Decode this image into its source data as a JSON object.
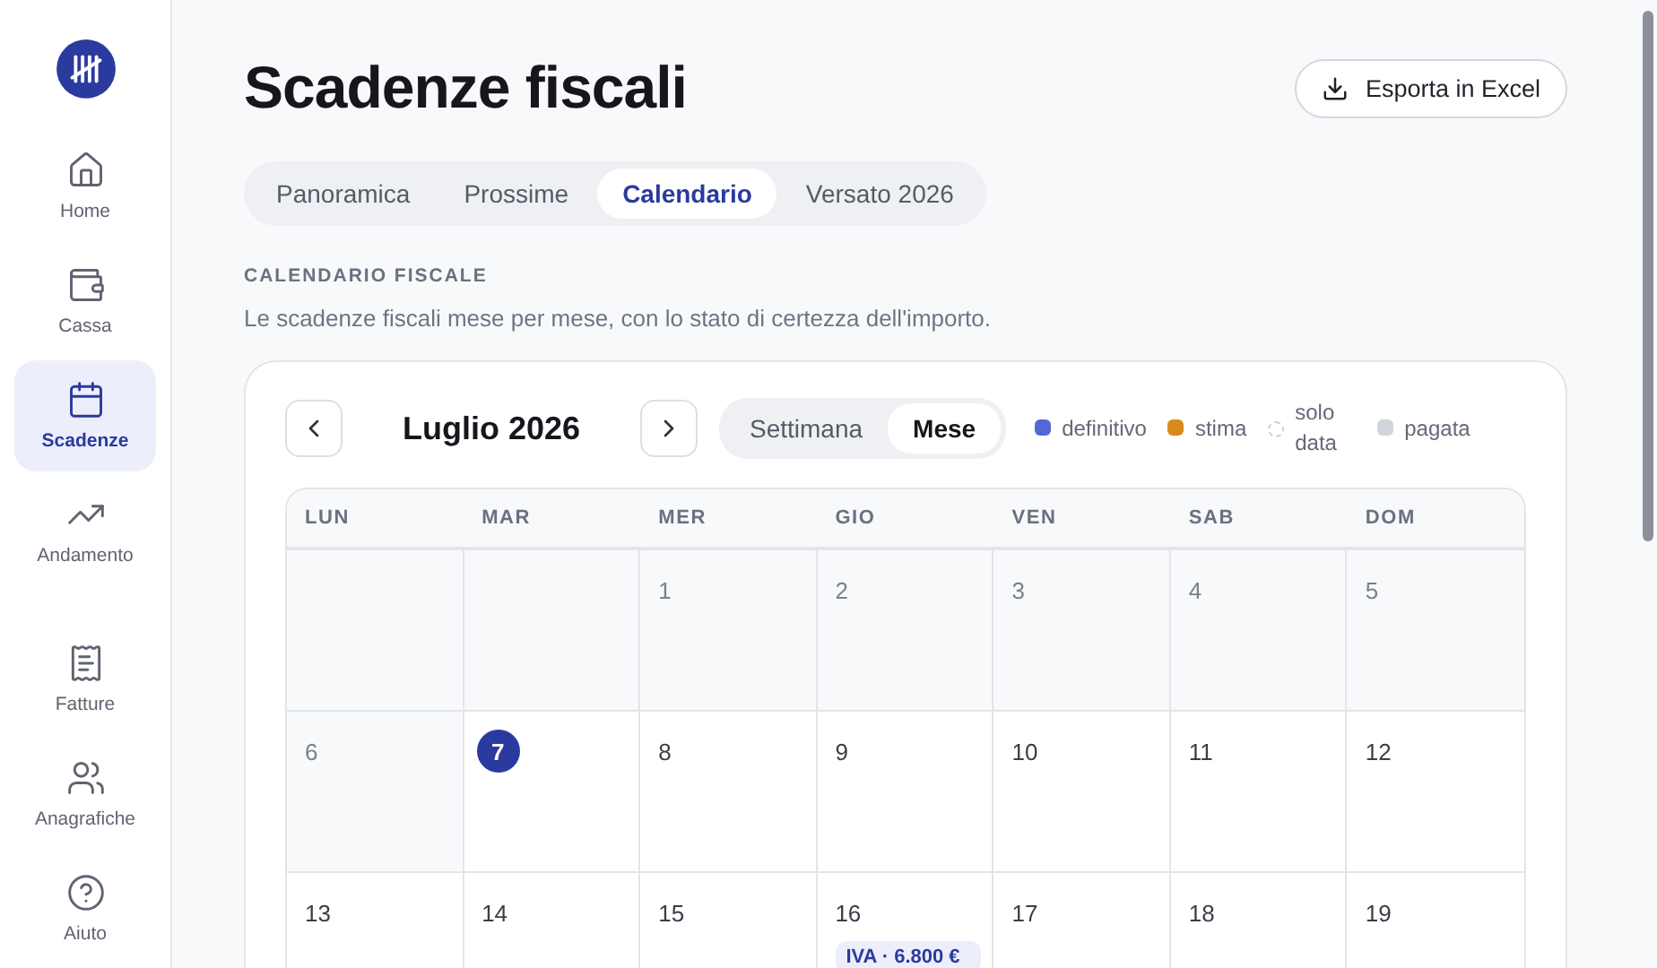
{
  "sidebar": {
    "items": [
      {
        "label": "Home",
        "selected": false
      },
      {
        "label": "Cassa",
        "selected": false
      },
      {
        "label": "Scadenze",
        "selected": true
      },
      {
        "label": "Andamento",
        "selected": false
      },
      {
        "label": "Fatture",
        "selected": false
      },
      {
        "label": "Anagrafiche",
        "selected": false
      },
      {
        "label": "Aiuto",
        "selected": false
      }
    ]
  },
  "title": "Scadenze fiscali",
  "export_button": "Esporta in Excel",
  "tabs": [
    {
      "label": "Panoramica",
      "selected": false
    },
    {
      "label": "Prossime",
      "selected": false
    },
    {
      "label": "Calendario",
      "selected": true
    },
    {
      "label": "Versato 2026",
      "selected": false
    }
  ],
  "section": {
    "heading": "CALENDARIO FISCALE",
    "description": "Le scadenze fiscali mese per mese, con lo stato di certezza dell'importo."
  },
  "calendar": {
    "month": "Luglio 2026",
    "views": [
      {
        "label": "Settimana",
        "selected": false
      },
      {
        "label": "Mese",
        "selected": true
      }
    ],
    "legend": [
      {
        "label": "definitivo",
        "kind": "solid",
        "color": "#5468d4"
      },
      {
        "label": "stima",
        "kind": "solid",
        "color": "#d98a1c"
      },
      {
        "label": "solo data",
        "kind": "dashed",
        "color": "#c9ccd3"
      },
      {
        "label": "pagata",
        "kind": "solid",
        "color": "#d1d5db"
      }
    ],
    "weekdays": [
      "LUN",
      "MAR",
      "MER",
      "GIO",
      "VEN",
      "SAB",
      "DOM"
    ],
    "weeks": [
      [
        {
          "kind": "blank"
        },
        {
          "kind": "blank"
        },
        {
          "kind": "day",
          "day": "1",
          "past": true,
          "today": false
        },
        {
          "kind": "day",
          "day": "2",
          "past": true,
          "today": false
        },
        {
          "kind": "day",
          "day": "3",
          "past": true,
          "today": false
        },
        {
          "kind": "day",
          "day": "4",
          "past": true,
          "today": false
        },
        {
          "kind": "day",
          "day": "5",
          "past": true,
          "today": false
        }
      ],
      [
        {
          "kind": "day",
          "day": "6",
          "past": true,
          "today": false
        },
        {
          "kind": "day",
          "day": "7",
          "past": false,
          "today": true
        },
        {
          "kind": "day",
          "day": "8",
          "past": false,
          "today": false
        },
        {
          "kind": "day",
          "day": "9",
          "past": false,
          "today": false
        },
        {
          "kind": "day",
          "day": "10",
          "past": false,
          "today": false
        },
        {
          "kind": "day",
          "day": "11",
          "past": false,
          "today": false
        },
        {
          "kind": "day",
          "day": "12",
          "past": false,
          "today": false
        }
      ],
      [
        {
          "kind": "day",
          "day": "13",
          "past": false,
          "today": false
        },
        {
          "kind": "day",
          "day": "14",
          "past": false,
          "today": false
        },
        {
          "kind": "day",
          "day": "15",
          "past": false,
          "today": false
        },
        {
          "kind": "day",
          "day": "16",
          "past": false,
          "today": false,
          "events": [
            {
              "label": "IVA · 6.800 €",
              "kind": "definitivo"
            }
          ]
        },
        {
          "kind": "day",
          "day": "17",
          "past": false,
          "today": false
        },
        {
          "kind": "day",
          "day": "18",
          "past": false,
          "today": false
        },
        {
          "kind": "day",
          "day": "19",
          "past": false,
          "today": false
        }
      ]
    ]
  }
}
